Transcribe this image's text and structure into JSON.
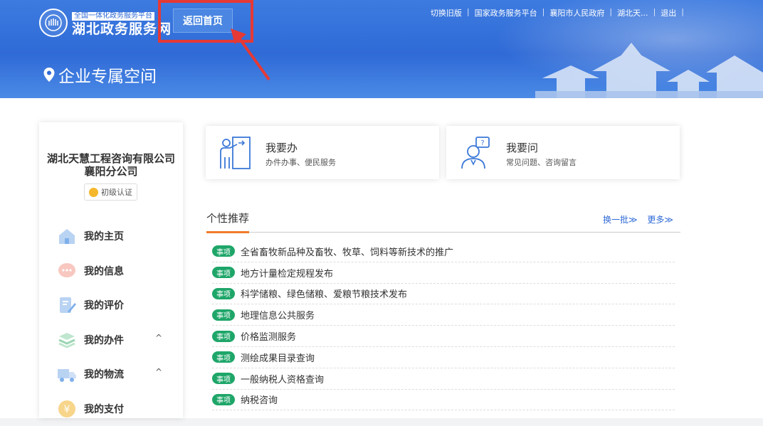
{
  "header": {
    "logo_sub": "全国一体化政务服务平台",
    "logo_main": "湖北政务服务网",
    "home_button": "返回首页",
    "top_links": [
      "切换旧版",
      "国家政务服务平台",
      "襄阳市人民政府",
      "湖北天...",
      "退出"
    ],
    "space_title": "企业专属空间"
  },
  "sidebar": {
    "company_line1": "湖北天慧工程咨询有限公司",
    "company_line2": "襄阳分公司",
    "cert_label": "初级认证",
    "items": [
      {
        "label": "我的主页",
        "icon": "home-icon"
      },
      {
        "label": "我的信息",
        "icon": "message-icon"
      },
      {
        "label": "我的评价",
        "icon": "edit-icon"
      },
      {
        "label": "我的办件",
        "icon": "layers-icon",
        "expand": "^"
      },
      {
        "label": "我的物流",
        "icon": "truck-icon",
        "expand": "^"
      },
      {
        "label": "我的支付",
        "icon": "payment-icon"
      }
    ]
  },
  "cards": [
    {
      "title": "我要办",
      "subtitle": "办件办事、便民服务",
      "icon": "handle-service-icon"
    },
    {
      "title": "我要问",
      "subtitle": "常见问题、咨询留言",
      "icon": "consult-icon"
    }
  ],
  "recommend": {
    "title": "个性推荐",
    "refresh": "换一批≫",
    "more": "更多≫",
    "badge": "事项",
    "items": [
      "全省畜牧新品种及畜牧、牧草、饲料等新技术的推广",
      "地方计量检定规程发布",
      "科学储粮、绿色储粮、爱粮节粮技术发布",
      "地理信息公共服务",
      "价格监测服务",
      "测绘成果目录查询",
      "一般纳税人资格查询",
      "纳税咨询"
    ]
  },
  "colors": {
    "banner": "#2f6ad6",
    "highlight_frame": "#e53935",
    "badge": "#1ea669",
    "tab_underline": "#f07c2a"
  }
}
